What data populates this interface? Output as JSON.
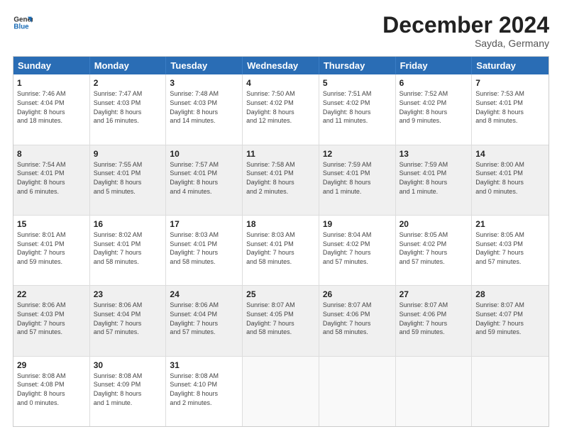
{
  "logo": {
    "line1": "General",
    "line2": "Blue"
  },
  "title": "December 2024",
  "subtitle": "Sayda, Germany",
  "days": [
    "Sunday",
    "Monday",
    "Tuesday",
    "Wednesday",
    "Thursday",
    "Friday",
    "Saturday"
  ],
  "rows": [
    [
      {
        "day": "1",
        "text": "Sunrise: 7:46 AM\nSunset: 4:04 PM\nDaylight: 8 hours\nand 18 minutes."
      },
      {
        "day": "2",
        "text": "Sunrise: 7:47 AM\nSunset: 4:03 PM\nDaylight: 8 hours\nand 16 minutes."
      },
      {
        "day": "3",
        "text": "Sunrise: 7:48 AM\nSunset: 4:03 PM\nDaylight: 8 hours\nand 14 minutes."
      },
      {
        "day": "4",
        "text": "Sunrise: 7:50 AM\nSunset: 4:02 PM\nDaylight: 8 hours\nand 12 minutes."
      },
      {
        "day": "5",
        "text": "Sunrise: 7:51 AM\nSunset: 4:02 PM\nDaylight: 8 hours\nand 11 minutes."
      },
      {
        "day": "6",
        "text": "Sunrise: 7:52 AM\nSunset: 4:02 PM\nDaylight: 8 hours\nand 9 minutes."
      },
      {
        "day": "7",
        "text": "Sunrise: 7:53 AM\nSunset: 4:01 PM\nDaylight: 8 hours\nand 8 minutes."
      }
    ],
    [
      {
        "day": "8",
        "text": "Sunrise: 7:54 AM\nSunset: 4:01 PM\nDaylight: 8 hours\nand 6 minutes."
      },
      {
        "day": "9",
        "text": "Sunrise: 7:55 AM\nSunset: 4:01 PM\nDaylight: 8 hours\nand 5 minutes."
      },
      {
        "day": "10",
        "text": "Sunrise: 7:57 AM\nSunset: 4:01 PM\nDaylight: 8 hours\nand 4 minutes."
      },
      {
        "day": "11",
        "text": "Sunrise: 7:58 AM\nSunset: 4:01 PM\nDaylight: 8 hours\nand 2 minutes."
      },
      {
        "day": "12",
        "text": "Sunrise: 7:59 AM\nSunset: 4:01 PM\nDaylight: 8 hours\nand 1 minute."
      },
      {
        "day": "13",
        "text": "Sunrise: 7:59 AM\nSunset: 4:01 PM\nDaylight: 8 hours\nand 1 minute."
      },
      {
        "day": "14",
        "text": "Sunrise: 8:00 AM\nSunset: 4:01 PM\nDaylight: 8 hours\nand 0 minutes."
      }
    ],
    [
      {
        "day": "15",
        "text": "Sunrise: 8:01 AM\nSunset: 4:01 PM\nDaylight: 7 hours\nand 59 minutes."
      },
      {
        "day": "16",
        "text": "Sunrise: 8:02 AM\nSunset: 4:01 PM\nDaylight: 7 hours\nand 58 minutes."
      },
      {
        "day": "17",
        "text": "Sunrise: 8:03 AM\nSunset: 4:01 PM\nDaylight: 7 hours\nand 58 minutes."
      },
      {
        "day": "18",
        "text": "Sunrise: 8:03 AM\nSunset: 4:01 PM\nDaylight: 7 hours\nand 58 minutes."
      },
      {
        "day": "19",
        "text": "Sunrise: 8:04 AM\nSunset: 4:02 PM\nDaylight: 7 hours\nand 57 minutes."
      },
      {
        "day": "20",
        "text": "Sunrise: 8:05 AM\nSunset: 4:02 PM\nDaylight: 7 hours\nand 57 minutes."
      },
      {
        "day": "21",
        "text": "Sunrise: 8:05 AM\nSunset: 4:03 PM\nDaylight: 7 hours\nand 57 minutes."
      }
    ],
    [
      {
        "day": "22",
        "text": "Sunrise: 8:06 AM\nSunset: 4:03 PM\nDaylight: 7 hours\nand 57 minutes."
      },
      {
        "day": "23",
        "text": "Sunrise: 8:06 AM\nSunset: 4:04 PM\nDaylight: 7 hours\nand 57 minutes."
      },
      {
        "day": "24",
        "text": "Sunrise: 8:06 AM\nSunset: 4:04 PM\nDaylight: 7 hours\nand 57 minutes."
      },
      {
        "day": "25",
        "text": "Sunrise: 8:07 AM\nSunset: 4:05 PM\nDaylight: 7 hours\nand 58 minutes."
      },
      {
        "day": "26",
        "text": "Sunrise: 8:07 AM\nSunset: 4:06 PM\nDaylight: 7 hours\nand 58 minutes."
      },
      {
        "day": "27",
        "text": "Sunrise: 8:07 AM\nSunset: 4:06 PM\nDaylight: 7 hours\nand 59 minutes."
      },
      {
        "day": "28",
        "text": "Sunrise: 8:07 AM\nSunset: 4:07 PM\nDaylight: 7 hours\nand 59 minutes."
      }
    ],
    [
      {
        "day": "29",
        "text": "Sunrise: 8:08 AM\nSunset: 4:08 PM\nDaylight: 8 hours\nand 0 minutes."
      },
      {
        "day": "30",
        "text": "Sunrise: 8:08 AM\nSunset: 4:09 PM\nDaylight: 8 hours\nand 1 minute."
      },
      {
        "day": "31",
        "text": "Sunrise: 8:08 AM\nSunset: 4:10 PM\nDaylight: 8 hours\nand 2 minutes."
      },
      {
        "day": "",
        "text": ""
      },
      {
        "day": "",
        "text": ""
      },
      {
        "day": "",
        "text": ""
      },
      {
        "day": "",
        "text": ""
      }
    ]
  ]
}
